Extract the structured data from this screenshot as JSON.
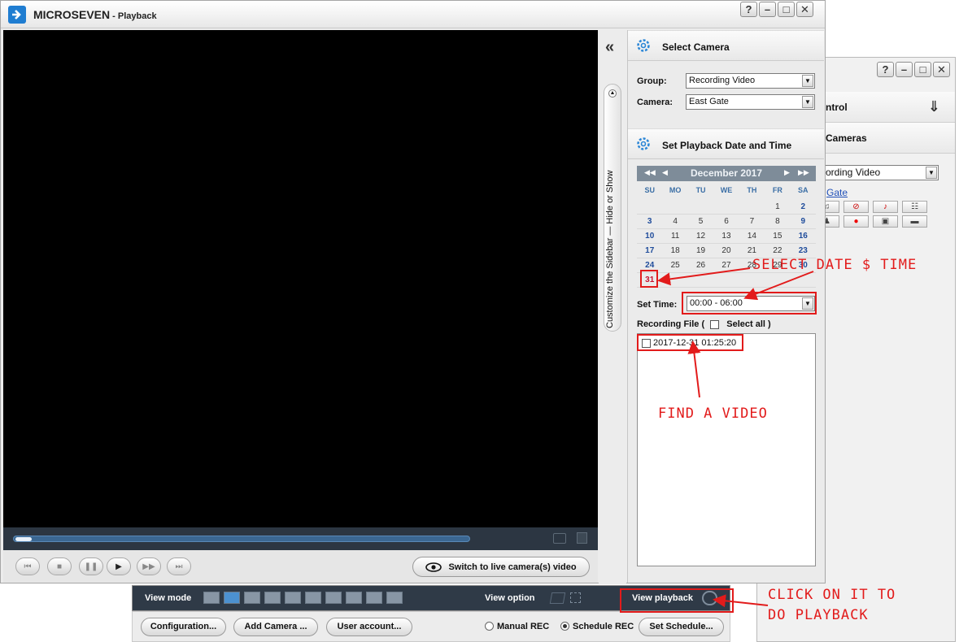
{
  "main_window": {
    "app_name": "MICROSEVEN",
    "app_section": " - Playback",
    "help_glyph": "?",
    "min_glyph": "–",
    "max_glyph": "□",
    "close_glyph": "✕"
  },
  "secondary_window": {
    "control_header": "ntrol",
    "cameras_header": "Cameras",
    "group_select": "ording Video",
    "camera_link": "Gate"
  },
  "sidebar_toggle": {
    "label": "Customize the Sidebar — Hide or Show"
  },
  "select_camera": {
    "title": "Select Camera",
    "group_label": "Group:",
    "group_value": "Recording Video",
    "camera_label": "Camera:",
    "camera_value": "East Gate"
  },
  "playback_date": {
    "title": "Set Playback Date and Time",
    "month": "December 2017",
    "weekdays": [
      "SU",
      "MO",
      "TU",
      "WE",
      "TH",
      "FR",
      "SA"
    ],
    "days": [
      "",
      "",
      "",
      "",
      "",
      "1",
      "2",
      "3",
      "4",
      "5",
      "6",
      "7",
      "8",
      "9",
      "10",
      "11",
      "12",
      "13",
      "14",
      "15",
      "16",
      "17",
      "18",
      "19",
      "20",
      "21",
      "22",
      "23",
      "24",
      "25",
      "26",
      "27",
      "28",
      "29",
      "30",
      "31",
      "",
      "",
      "",
      "",
      "",
      ""
    ],
    "selected_day": "31",
    "set_time_label": "Set Time:",
    "time_value": "00:00 - 06:00",
    "recording_file_label": "Recording File   (",
    "select_all_label": "Select all  )",
    "file_entry": "2017-12-31 01:25:20"
  },
  "player": {
    "progress": 0.035,
    "live_button": "Switch to live camera(s) video"
  },
  "view_bar": {
    "view_mode_label": "View mode",
    "view_option_label": "View option",
    "view_playback_label": "View playback"
  },
  "buttons": {
    "configuration": "Configuration...",
    "add_camera": "Add Camera ...",
    "user_account": "User account...",
    "manual_rec": "Manual REC",
    "schedule_rec": "Schedule REC",
    "set_schedule": "Set Schedule..."
  },
  "annotations": {
    "select_date_time": "SELECT DATE $ TIME",
    "find_video": "FIND A VIDEO",
    "click_line1": "CLICK ON IT TO",
    "click_line2": "DO PLAYBACK"
  },
  "colors": {
    "annotation_red": "#e21b1b",
    "accent_blue": "#1f7dd1",
    "video_bg": "#000000"
  }
}
